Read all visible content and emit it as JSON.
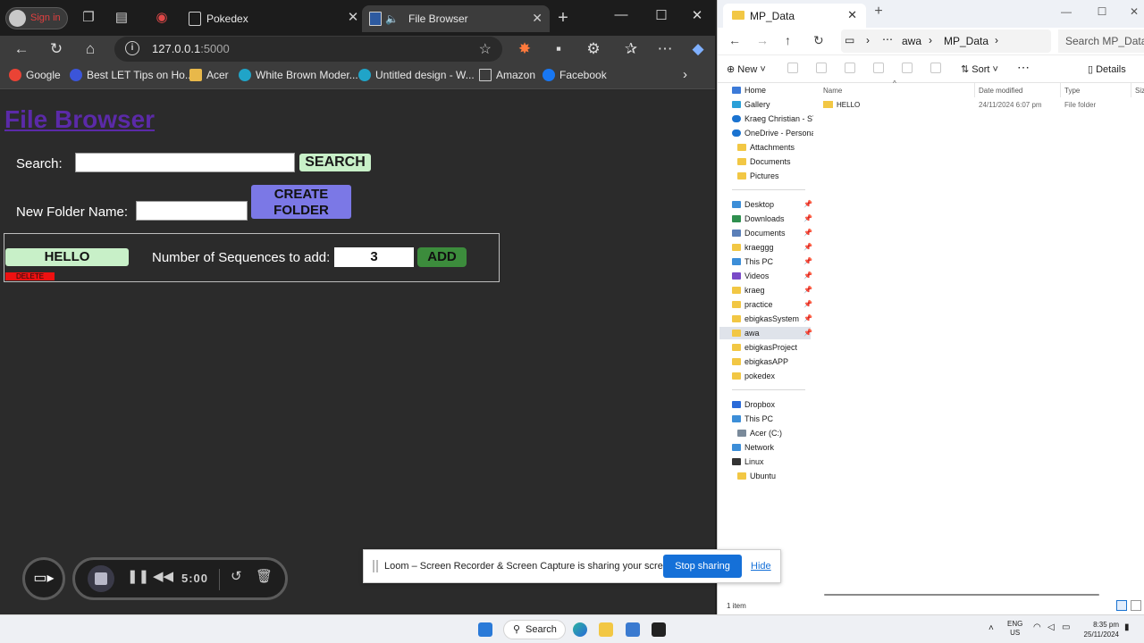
{
  "browser": {
    "profile_label": "Sign in",
    "tabs": [
      {
        "title": "Pokedex",
        "active": false
      },
      {
        "title": "File Browser",
        "active": true
      }
    ],
    "url_host": "127.0.0.1",
    "url_port": ":5000",
    "bookmarks": [
      {
        "label": "Google",
        "icon": "google-icon"
      },
      {
        "label": "Best LET Tips on Ho...",
        "icon": "bookmark-icon"
      },
      {
        "label": "Acer",
        "icon": "folder-icon"
      },
      {
        "label": "White Brown Moder...",
        "icon": "canva-icon"
      },
      {
        "label": "Untitled design - W...",
        "icon": "canva-icon"
      },
      {
        "label": "Amazon",
        "icon": "page-icon"
      },
      {
        "label": "Facebook",
        "icon": "facebook-icon"
      }
    ]
  },
  "page": {
    "title": "File Browser",
    "search_label": "Search:",
    "search_value": "",
    "search_button": "SEARCH",
    "new_folder_label": "New Folder Name:",
    "new_folder_value": "",
    "create_button_line1": "CREATE",
    "create_button_line2": "FOLDER",
    "folders": [
      {
        "name": "HELLO",
        "delete_label": "DELETE",
        "seq_label": "Number of Sequences to add:",
        "seq_value": "3",
        "add_label": "ADD"
      }
    ]
  },
  "loom": {
    "timer": "5:00",
    "banner_message": "Loom – Screen Recorder & Screen Capture is sharing your screen.",
    "stop_sharing": "Stop sharing",
    "hide": "Hide"
  },
  "explorer": {
    "tab_title": "MP_Data",
    "path": [
      "awa",
      "MP_Data"
    ],
    "search_placeholder": "Search MP_Data",
    "commands": {
      "new": "New",
      "sort": "Sort",
      "details": "Details"
    },
    "nav_top": [
      {
        "label": "Home",
        "icon": "home-icon"
      },
      {
        "label": "Gallery",
        "icon": "gallery-icon"
      },
      {
        "label": "Kraeg Christian - STI",
        "icon": "cloud-icon"
      },
      {
        "label": "OneDrive - Personal",
        "icon": "cloud-icon"
      },
      {
        "label": "Attachments",
        "icon": "folder-icon"
      },
      {
        "label": "Documents",
        "icon": "folder-icon"
      },
      {
        "label": "Pictures",
        "icon": "folder-icon"
      }
    ],
    "nav_quick": [
      {
        "label": "Desktop",
        "icon": "desktop-icon"
      },
      {
        "label": "Downloads",
        "icon": "download-icon"
      },
      {
        "label": "Documents",
        "icon": "documents-icon"
      },
      {
        "label": "kraeggg",
        "icon": "folder-icon"
      },
      {
        "label": "This PC",
        "icon": "pc-icon"
      },
      {
        "label": "Videos",
        "icon": "videos-icon"
      },
      {
        "label": "kraeg",
        "icon": "folder-icon"
      },
      {
        "label": "practice",
        "icon": "folder-icon"
      },
      {
        "label": "ebigkasSystem",
        "icon": "folder-icon"
      },
      {
        "label": "awa",
        "icon": "folder-icon"
      },
      {
        "label": "ebigkasProject",
        "icon": "folder-icon"
      },
      {
        "label": "ebigkasAPP",
        "icon": "folder-icon"
      },
      {
        "label": "pokedex",
        "icon": "folder-icon"
      }
    ],
    "nav_bottom": [
      {
        "label": "Dropbox",
        "icon": "dropbox-icon"
      },
      {
        "label": "This PC",
        "icon": "pc-icon"
      },
      {
        "label": "Acer (C:)",
        "icon": "drive-icon"
      },
      {
        "label": "Network",
        "icon": "network-icon"
      },
      {
        "label": "Linux",
        "icon": "linux-icon"
      },
      {
        "label": "Ubuntu",
        "icon": "folder-icon"
      }
    ],
    "columns": [
      "Name",
      "Date modified",
      "Type",
      "Size"
    ],
    "files": [
      {
        "name": "HELLO",
        "date": "24/11/2024 6:07 pm",
        "type": "File folder"
      }
    ],
    "status": "1 item"
  },
  "taskbar": {
    "search_label": "Search",
    "lang": "ENG",
    "region": "US",
    "time": "8:35 pm",
    "date": "25/11/2024"
  },
  "colors": {
    "title_link": "#5b2aa8",
    "green_button": "#c8f0c8",
    "create_button": "#7b78e6",
    "delete_button": "#ee1111",
    "add_button": "#3c8c3c",
    "loom_blue": "#1570d8"
  }
}
